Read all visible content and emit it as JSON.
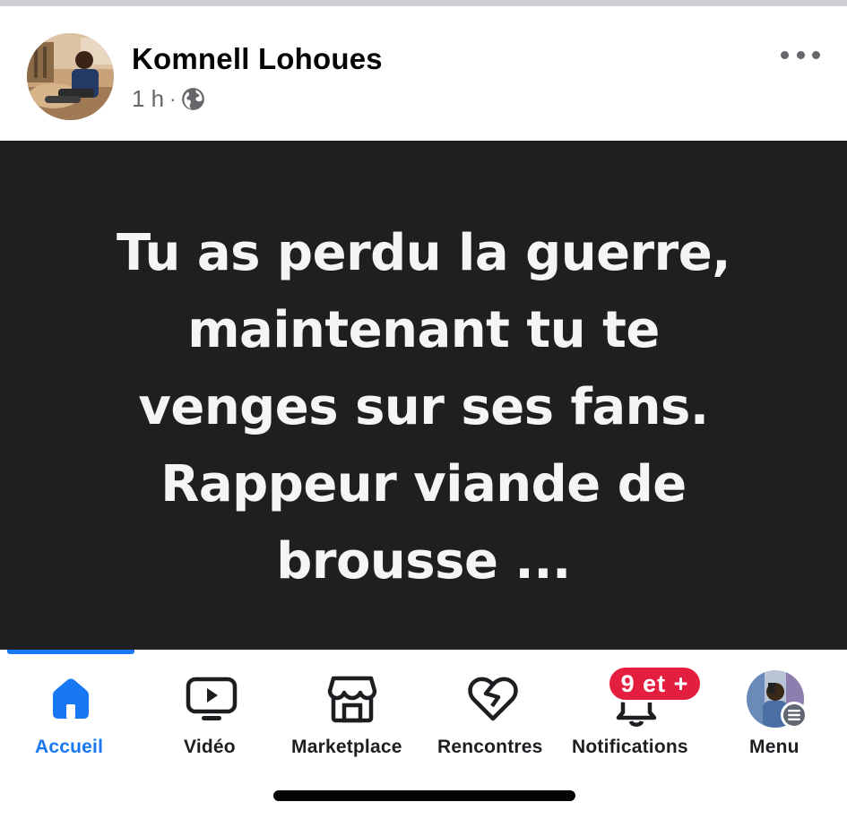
{
  "post": {
    "author": "Komnell Lohoues",
    "time": "1 h",
    "separator": "·",
    "audience_icon": "globe-icon",
    "more_icon": "more-horizontal-icon",
    "text_lines": [
      "Tu as perdu la guerre,",
      "maintenant tu te",
      "venges sur ses fans.",
      "Rappeur viande de",
      "brousse ..."
    ],
    "background_color": "#1f1f1f",
    "text_color": "#f5f5f5"
  },
  "nav": {
    "items": [
      {
        "label": "Accueil",
        "icon": "home-icon",
        "active": true
      },
      {
        "label": "Vidéo",
        "icon": "video-icon",
        "active": false
      },
      {
        "label": "Marketplace",
        "icon": "marketplace-icon",
        "active": false
      },
      {
        "label": "Rencontres",
        "icon": "heart-icon",
        "active": false
      },
      {
        "label": "Notifications",
        "icon": "bell-icon",
        "active": false
      },
      {
        "label": "Menu",
        "icon": "menu-avatar",
        "active": false
      }
    ],
    "notifications_badge": "9 et +"
  },
  "colors": {
    "accent": "#1877f2",
    "badge": "#e41e3f"
  }
}
